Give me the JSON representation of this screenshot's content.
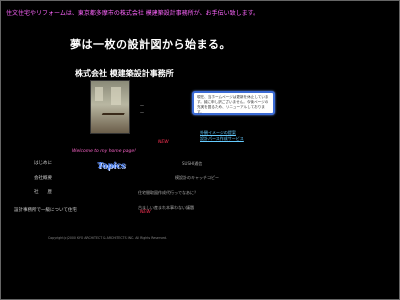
{
  "ticker": "住文住宅やリフォームは、東京都多摩市の株式会社 模建築設計事務所が、お手伝い致します。",
  "headline": "夢は一枚の設計図から始まる。",
  "company": "株式会社 模建築設計事務所",
  "photo_captions": [
    "—",
    "—"
  ],
  "notice": "現在、当ホームページは更新を休止しています。誠に申し訳ございません。今後ページの充実を図るため、リニューアルしております。",
  "side_links": [
    "外観イメージの提案",
    "設計パース作成サービス"
  ],
  "new_label": "NEW",
  "welcome": "Welcome to my home page!",
  "topics_title": "Topics",
  "nav": [
    "はじめに",
    "会社概要",
    "社　　歴",
    "設計事務所で一級について住宅"
  ],
  "topics": [
    "SUSHI通信",
    "模設計のキャッチコピー",
    "住宅間取図作成代行っでなあに？",
    "古ましい産まれ本事わない議題"
  ],
  "footer": "Copyright(c)2000 KYO ARCHITECT & ARCHITECTS INC. All Rights Reserved.",
  "colors": {
    "background": "#000000",
    "ticker": "#ff66ff",
    "link": "#66ccff",
    "new": "#ff3355",
    "topics": "#5a8fff",
    "notice_border": "#3b6bd6"
  }
}
